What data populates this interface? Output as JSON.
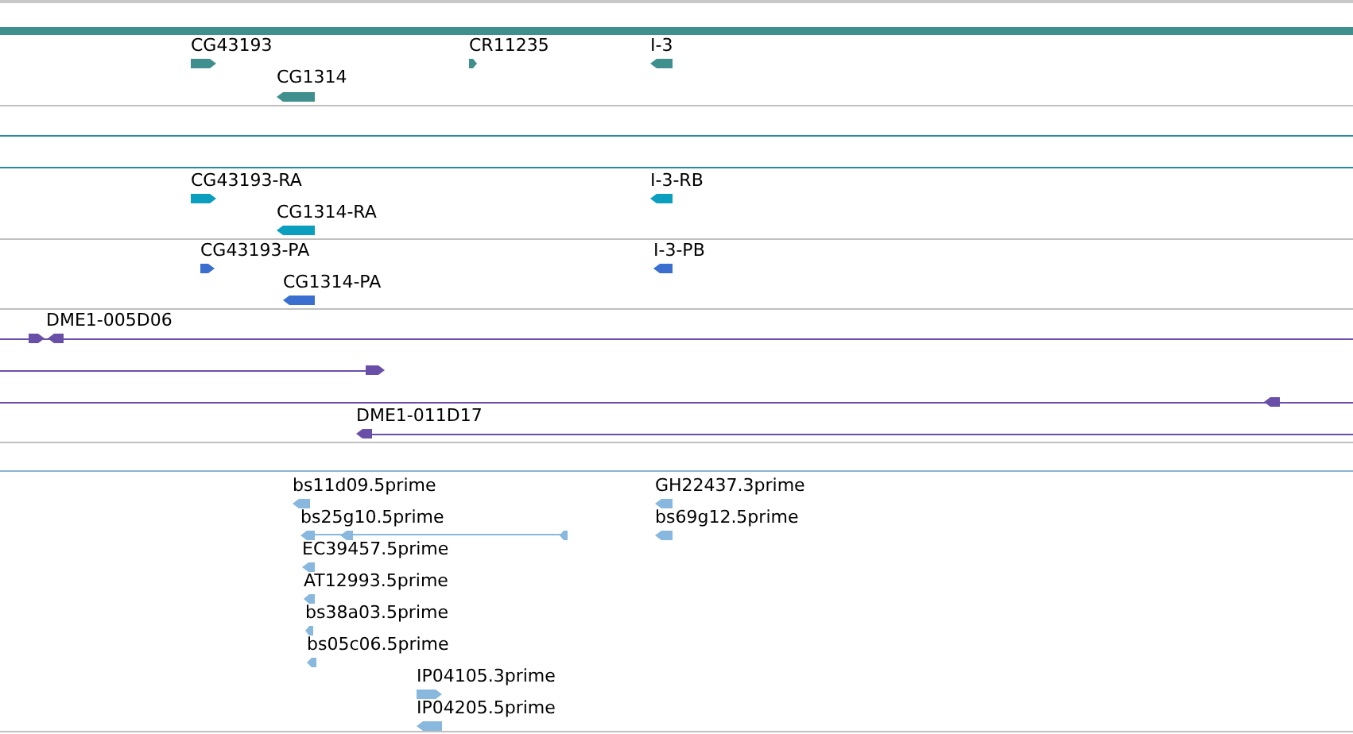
{
  "tracks": [
    {
      "color": "#3f8f8f",
      "features": [
        {
          "label": "CG43193",
          "reverse": false
        },
        {
          "label": "CR11235",
          "reverse": false
        },
        {
          "label": "I-3",
          "reverse": true
        },
        {
          "label": "CG1314",
          "reverse": true
        }
      ]
    },
    {
      "color": "#0a9fbf",
      "features": [
        {
          "label": "CG43193-RA",
          "reverse": false
        },
        {
          "label": "I-3-RB",
          "reverse": true
        },
        {
          "label": "CG1314-RA",
          "reverse": true
        }
      ]
    },
    {
      "color": "#3a6fd0",
      "features": [
        {
          "label": "CG43193-PA",
          "reverse": false
        },
        {
          "label": "I-3-PB",
          "reverse": true
        },
        {
          "label": "CG1314-PA",
          "reverse": true
        }
      ]
    },
    {
      "color": "#6a4fa8",
      "features": [
        {
          "label": "DME1-005D06",
          "reverse": false
        },
        {
          "reverse": true
        },
        {
          "reverse": false
        },
        {
          "reverse": true
        },
        {
          "label": "DME1-011D17",
          "reverse": true
        }
      ]
    },
    {
      "color": "#88b8dd",
      "features": [
        {
          "label": "bs11d09.5prime",
          "reverse": true
        },
        {
          "label": "bs25g10.5prime",
          "reverse": true
        },
        {
          "reverse": true
        },
        {
          "reverse": true
        },
        {
          "label": "EC39457.5prime",
          "reverse": true
        },
        {
          "label": "AT12993.5prime",
          "reverse": true
        },
        {
          "label": "bs38a03.5prime",
          "reverse": true
        },
        {
          "label": "bs05c06.5prime",
          "reverse": true
        },
        {
          "label": "IP04105.3prime",
          "reverse": false
        },
        {
          "label": "IP04205.5prime",
          "reverse": true
        },
        {
          "label": "GH22437.3prime",
          "reverse": true
        },
        {
          "label": "bs69g12.5prime",
          "reverse": true
        }
      ]
    }
  ]
}
